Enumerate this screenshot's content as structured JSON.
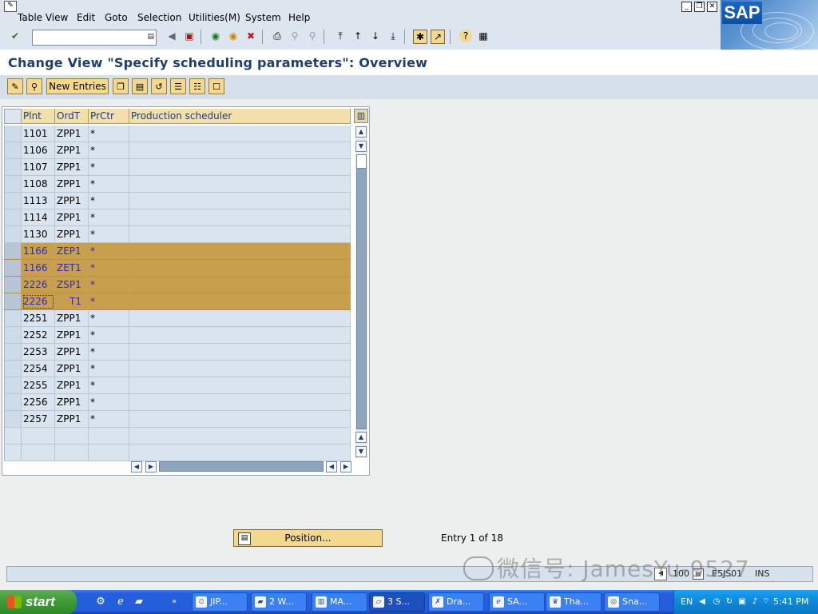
{
  "menu": {
    "items": [
      "Table View",
      "Edit",
      "Goto",
      "Selection",
      "Utilities(M)",
      "System",
      "Help"
    ]
  },
  "logo": {
    "text": "SAP"
  },
  "toolbar": {
    "command_value": ""
  },
  "page": {
    "title": "Change View \"Specify scheduling parameters\": Overview"
  },
  "app_toolbar": {
    "new_entries_label": "New Entries"
  },
  "table": {
    "headers": {
      "plant": "Plnt",
      "order_type": "OrdT",
      "profit_center": "PrCtr",
      "scheduler": "Production scheduler"
    },
    "rows": [
      {
        "plant": "1101",
        "order_type": "ZPP1",
        "profit_center": "*",
        "scheduler": ""
      },
      {
        "plant": "1106",
        "order_type": "ZPP1",
        "profit_center": "*",
        "scheduler": ""
      },
      {
        "plant": "1107",
        "order_type": "ZPP1",
        "profit_center": "*",
        "scheduler": ""
      },
      {
        "plant": "1108",
        "order_type": "ZPP1",
        "profit_center": "*",
        "scheduler": ""
      },
      {
        "plant": "1113",
        "order_type": "ZPP1",
        "profit_center": "*",
        "scheduler": ""
      },
      {
        "plant": "1114",
        "order_type": "ZPP1",
        "profit_center": "*",
        "scheduler": ""
      },
      {
        "plant": "1130",
        "order_type": "ZPP1",
        "profit_center": "*",
        "scheduler": ""
      },
      {
        "plant": "1166",
        "order_type": "ZEP1",
        "profit_center": "*",
        "scheduler": ""
      },
      {
        "plant": "1166",
        "order_type": "ZET1",
        "profit_center": "*",
        "scheduler": ""
      },
      {
        "plant": "2226",
        "order_type": "ZSP1",
        "profit_center": "*",
        "scheduler": ""
      },
      {
        "plant": "2226",
        "order_type": "T1",
        "profit_center": "*",
        "scheduler": ""
      },
      {
        "plant": "2251",
        "order_type": "ZPP1",
        "profit_center": "*",
        "scheduler": ""
      },
      {
        "plant": "2252",
        "order_type": "ZPP1",
        "profit_center": "*",
        "scheduler": ""
      },
      {
        "plant": "2253",
        "order_type": "ZPP1",
        "profit_center": "*",
        "scheduler": ""
      },
      {
        "plant": "2254",
        "order_type": "ZPP1",
        "profit_center": "*",
        "scheduler": ""
      },
      {
        "plant": "2255",
        "order_type": "ZPP1",
        "profit_center": "*",
        "scheduler": ""
      },
      {
        "plant": "2256",
        "order_type": "ZPP1",
        "profit_center": "*",
        "scheduler": ""
      },
      {
        "plant": "2257",
        "order_type": "ZPP1",
        "profit_center": "*",
        "scheduler": ""
      },
      {
        "plant": "",
        "order_type": "",
        "profit_center": "",
        "scheduler": ""
      },
      {
        "plant": "",
        "order_type": "",
        "profit_center": "",
        "scheduler": ""
      }
    ],
    "highlighted_rows": [
      7,
      8,
      9,
      10
    ]
  },
  "position_button": {
    "label": "Position..."
  },
  "entry_info": "Entry 1 of 18",
  "statusbar": {
    "client": "100",
    "server": "E5JS01",
    "mode": "INS"
  },
  "watermark": "微信号: JamesYu-9527",
  "taskbar": {
    "start_label": "start",
    "tasks": [
      "JIP...",
      "2 W...",
      "MA...",
      "3 S...",
      "Dra...",
      "SA...",
      "Tha...",
      "Sna..."
    ],
    "language": "EN",
    "clock": "5:41 PM"
  },
  "colors": {
    "highlight_row": "#c89f4c",
    "header_bg": "#f3dfaa",
    "title_text": "#1d3f6e",
    "toolbar_bg": "#dde5ef"
  }
}
